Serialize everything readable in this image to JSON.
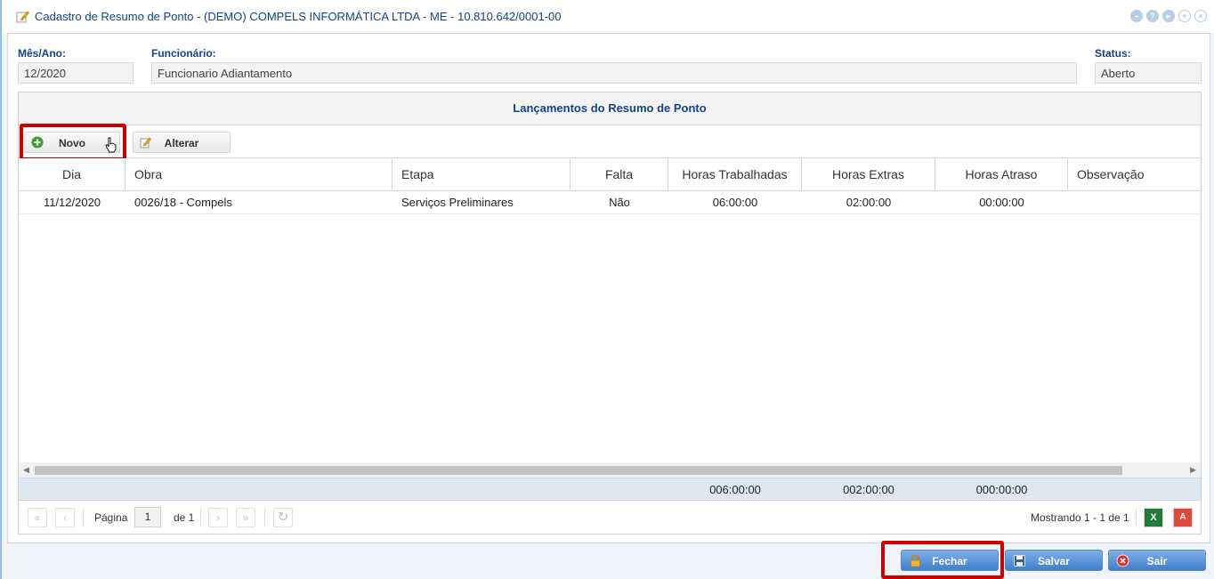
{
  "window": {
    "title": "Cadastro de Resumo de Ponto - (DEMO) COMPELS INFORMÁTICA LTDA - ME - 10.810.642/0001-00",
    "tools": [
      "minimize-icon",
      "help-icon",
      "next-icon",
      "move-icon",
      "close-icon"
    ]
  },
  "form": {
    "mes_ano_label": "Mês/Ano:",
    "mes_ano_value": "12/2020",
    "funcionario_label": "Funcionário:",
    "funcionario_value": "Funcionario Adiantamento",
    "status_label": "Status:",
    "status_value": "Aberto"
  },
  "grid": {
    "title": "Lançamentos do Resumo de Ponto",
    "toolbar": {
      "novo_label": "Novo",
      "alterar_label": "Alterar"
    },
    "columns": [
      "Dia",
      "Obra",
      "Etapa",
      "Falta",
      "Horas Trabalhadas",
      "Horas Extras",
      "Horas Atraso",
      "Observação"
    ],
    "rows": [
      {
        "dia": "11/12/2020",
        "obra": "0026/18 - Compels",
        "etapa": "Serviços Preliminares",
        "falta": "Não",
        "horas_trabalhadas": "06:00:00",
        "horas_extras": "02:00:00",
        "horas_atraso": "00:00:00",
        "observacao": ""
      }
    ],
    "summary": {
      "horas_trabalhadas": "006:00:00",
      "horas_extras": "002:00:00",
      "horas_atraso": "000:00:00"
    },
    "paging": {
      "page_label": "Página",
      "page_value": "1",
      "of_label": "de 1",
      "display_text": "Mostrando 1 - 1 de 1"
    }
  },
  "buttons": {
    "fechar": "Fechar",
    "salvar": "Salvar",
    "sair": "Sair"
  },
  "colors": {
    "title_blue": "#15428b",
    "highlight_red": "#cc0000",
    "button_blue": "#3e7fce"
  }
}
